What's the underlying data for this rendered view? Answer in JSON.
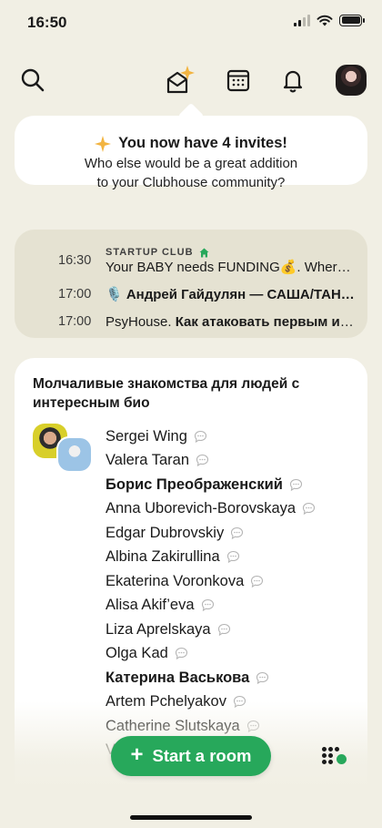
{
  "status_bar": {
    "time": "16:50"
  },
  "nav": {
    "icons": [
      "search-icon",
      "invite-envelope-icon",
      "calendar-icon",
      "bell-icon",
      "profile-avatar"
    ]
  },
  "invite_banner": {
    "title": "You now have 4 invites!",
    "body_line1": "Who else would be a great addition",
    "body_line2": "to your Clubhouse community?"
  },
  "schedule": [
    {
      "time": "16:30",
      "club": "STARTUP CLUB",
      "title": "Your BABY needs FUNDING💰. Where to find it?"
    },
    {
      "time": "17:00",
      "club": "",
      "title": "🎙️ Андрей Гайдулян — САША/ТАНЯ и другие проекты"
    },
    {
      "time": "17:00",
      "club": "",
      "title_plain": "PsyHouse. ",
      "title_bold": "Как атаковать первым и не проиграть"
    }
  ],
  "suggestions": {
    "title": "Молчаливые знакомства для людей с интересным био",
    "people": [
      {
        "name": "Sergei Wing",
        "bold": false
      },
      {
        "name": "Valera Taran",
        "bold": false
      },
      {
        "name": "Борис Преображенский",
        "bold": true
      },
      {
        "name": "Anna Uborevich-Borovskaya",
        "bold": false
      },
      {
        "name": "Edgar Dubrovskiy",
        "bold": false
      },
      {
        "name": "Albina Zakirullina",
        "bold": false
      },
      {
        "name": "Ekaterina Voronkova",
        "bold": false
      },
      {
        "name": "Alisa Akif’eva",
        "bold": false
      },
      {
        "name": "Liza Aprelskaya",
        "bold": false
      },
      {
        "name": "Olga Kad",
        "bold": false
      },
      {
        "name": "Катерина Васькова",
        "bold": true
      },
      {
        "name": "Artem Pchelyakov",
        "bold": false
      },
      {
        "name": "Catherine Slutskaya",
        "bold": false
      },
      {
        "name": "V",
        "bold": false
      }
    ]
  },
  "start_room": {
    "label": "Start a room"
  },
  "colors": {
    "background": "#f1efe4",
    "accent_green": "#27a85b",
    "schedule_bg": "#e5e2d2"
  }
}
